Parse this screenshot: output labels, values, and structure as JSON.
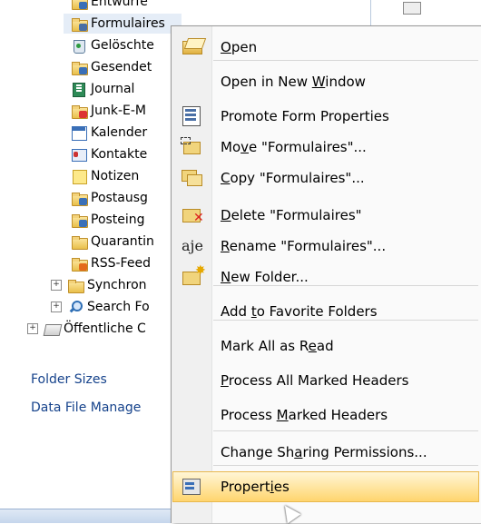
{
  "folders": [
    {
      "label": "Entwürfe",
      "icon": "drafts-icon"
    },
    {
      "label": "Formulaires",
      "icon": "forms-folder-icon",
      "selected": true
    },
    {
      "label": "Gelöschte",
      "icon": "trash-icon"
    },
    {
      "label": "Gesendet",
      "icon": "sent-folder-icon"
    },
    {
      "label": "Journal",
      "icon": "journal-icon"
    },
    {
      "label": "Junk-E-M",
      "icon": "junk-folder-icon"
    },
    {
      "label": "Kalender",
      "icon": "calendar-icon"
    },
    {
      "label": "Kontakte",
      "icon": "contacts-icon"
    },
    {
      "label": "Notizen",
      "icon": "notes-icon"
    },
    {
      "label": "Postausg",
      "icon": "outbox-icon"
    },
    {
      "label": "Posteing",
      "icon": "inbox-icon"
    },
    {
      "label": "Quarantin",
      "icon": "folder-icon"
    },
    {
      "label": "RSS-Feed",
      "icon": "rss-folder-icon"
    },
    {
      "label": "Synchron",
      "icon": "folder-icon",
      "expander": "+"
    },
    {
      "label": "Search Fo",
      "icon": "search-folder-icon",
      "expander": "+"
    },
    {
      "label": "Öffentliche C",
      "icon": "public-folders-icon",
      "expander": "+"
    }
  ],
  "links": {
    "folder_sizes": "Folder Sizes",
    "data_file_management": "Data File Manage"
  },
  "menu": {
    "items": [
      {
        "pre": "",
        "key": "O",
        "post": "pen",
        "icon": "open-folder-icon"
      },
      {
        "pre": "Open in New ",
        "key": "W",
        "post": "indow",
        "icon": ""
      },
      {
        "pre": "Promote Form Properties",
        "key": "",
        "post": "",
        "icon": "form-properties-icon"
      },
      {
        "pre": "Mo",
        "key": "v",
        "post": "e \"Formulaires\"...",
        "icon": "move-folder-icon"
      },
      {
        "pre": "",
        "key": "C",
        "post": "opy \"Formulaires\"...",
        "icon": "copy-folder-icon"
      },
      {
        "pre": "",
        "key": "D",
        "post": "elete \"Formulaires\"",
        "icon": "delete-folder-icon"
      },
      {
        "pre": "",
        "key": "R",
        "post": "ename \"Formulaires\"...",
        "icon": "rename-icon"
      },
      {
        "pre": "",
        "key": "N",
        "post": "ew Folder...",
        "icon": "new-folder-icon"
      },
      {
        "pre": "Add ",
        "key": "t",
        "post": "o Favorite Folders",
        "icon": ""
      },
      {
        "pre": "Mark All as R",
        "key": "e",
        "post": "ad",
        "icon": ""
      },
      {
        "pre": "",
        "key": "P",
        "post": "rocess All Marked Headers",
        "icon": ""
      },
      {
        "pre": "Process ",
        "key": "M",
        "post": "arked Headers",
        "icon": ""
      },
      {
        "pre": "Change Sh",
        "key": "a",
        "post": "ring Permissions...",
        "icon": ""
      },
      {
        "pre": "Propert",
        "key": "i",
        "post": "es",
        "icon": "properties-icon",
        "highlighted": true
      }
    ]
  },
  "colors": {
    "link": "#15428b",
    "highlight": "#ffd56e",
    "selection": "#e5edf7"
  }
}
